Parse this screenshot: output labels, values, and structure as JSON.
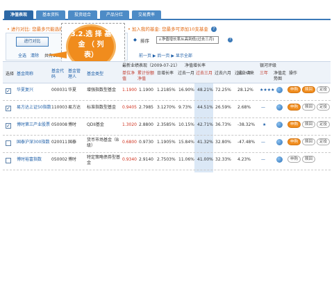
{
  "tabs": [
    {
      "label": "净值表现",
      "active": true
    },
    {
      "label": "基本资料",
      "active": false
    },
    {
      "label": "投资组合",
      "active": false
    },
    {
      "label": "产品分红",
      "active": false
    },
    {
      "label": "交易费率",
      "active": false
    }
  ],
  "notice": {
    "compare": "• 进行对比: 您最多只能选择5只基金",
    "mine": "• 加入我的基金: 您最多可添加10支基金"
  },
  "callout": {
    "line1": "3.2.选 择 基",
    "line2": "金 （ 列",
    "line3": "表）"
  },
  "toolbar": {
    "compare_button": "进行对比",
    "select_all": "全选",
    "clear": "清除",
    "total": "共有100",
    "sort_label": "排序",
    "sort_value": "↓净值增长率从高到低(过去三月)",
    "pager": "前一页 ▶ 后一页 ▶ 显示全部"
  },
  "header": {
    "select": "选择",
    "fund_name": "基金简称",
    "fund_code": "基金代码",
    "manager": "基金管理人",
    "fund_type": "基金类型",
    "latest_perf": "最新业绩表现（2009-07-21）",
    "nav_growth": "净值增长率",
    "unit_nav": "单位净值",
    "acc_nav": "累计份额净值",
    "daily": "日增长率",
    "past_1m": "过去一月",
    "past_3m": "过去三月",
    "past_6m": "过去六月",
    "past_1y": "过去一年",
    "since_inception": "成立以来",
    "galaxy_rating": "银河评级",
    "three_year": "三年",
    "nav_chart": "净值走势图",
    "action": "操作"
  },
  "rows": [
    {
      "checked": true,
      "name": "华夏复兴",
      "code": "000031",
      "manager": "华夏",
      "type": "增强指数型基金",
      "unit": "1.1900",
      "acc": "1.1900",
      "daily": "1.2185%",
      "m1": "16.90%",
      "m3": "48.21%",
      "m6": "72.25%",
      "y1": "",
      "since": "28.12%",
      "stars": "★★★★",
      "buttons": [
        "申购",
        "赎回",
        "定投"
      ]
    },
    {
      "checked": true,
      "name": "易方达上证50指数",
      "code": "110003",
      "manager": "易方达",
      "type": "标准指数型基金",
      "unit": "0.9405",
      "acc": "2.7985",
      "daily": "3.1270%",
      "m1": "9.73%",
      "m3": "44.51%",
      "m6": "26.59%",
      "y1": "",
      "since": "2.68%",
      "stars": "—",
      "buttons": [
        "申购",
        "赎回",
        "定投"
      ]
    },
    {
      "checked": true,
      "name": "博时第三产业股票",
      "code": "050008",
      "manager": "博时",
      "type": "QDII基金",
      "unit": "1.3020",
      "acc": "2.8800",
      "daily": "2.3585%",
      "m1": "10.15%",
      "m3": "42.71%",
      "m6": "36.73%",
      "y1": "",
      "since": "-38.32%",
      "stars": "★",
      "buttons": [
        "申购",
        "赎回",
        "定投"
      ]
    },
    {
      "checked": false,
      "name": "国泰沪深300指数",
      "code": "020011",
      "manager": "国泰",
      "type": "货币市场基金（B级）",
      "unit": "0.6800",
      "acc": "0.9730",
      "daily": "1.1905%",
      "m1": "15.84%",
      "m3": "41.32%",
      "m6": "32.80%",
      "y1": "",
      "since": "-47.48%",
      "stars": "—",
      "buttons": [
        "申购",
        "赎回",
        "定投"
      ]
    },
    {
      "checked": false,
      "name": "博时裕富指数",
      "code": "050002",
      "manager": "博时",
      "type": "特定策略债券型基金",
      "unit": "0.9340",
      "acc": "2.9140",
      "daily": "2.7503%",
      "m1": "11.06%",
      "m3": "41.00%",
      "m6": "32.33%",
      "y1": "",
      "since": "4.23%",
      "stars": "—",
      "buttons": [
        "申购",
        "赎回"
      ]
    }
  ]
}
